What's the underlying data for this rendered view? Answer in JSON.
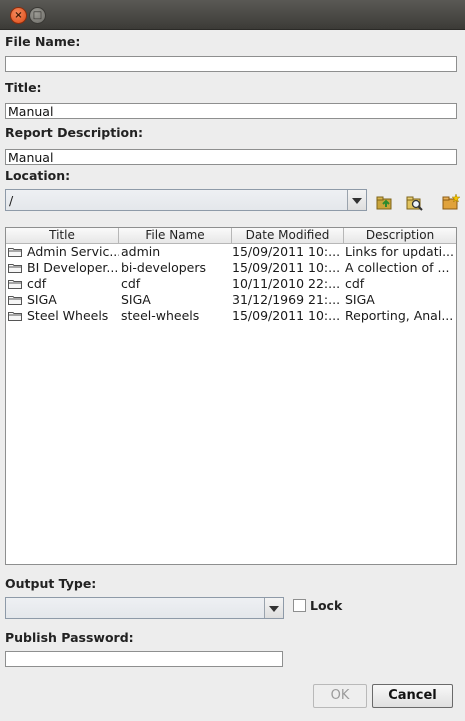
{
  "window": {
    "close_glyph": "×",
    "maximize_glyph": "□"
  },
  "form": {
    "file_name_label": "File Name:",
    "file_name_value": "",
    "title_label": "Title:",
    "title_value": "Manual",
    "description_label": "Report Description:",
    "description_value": "Manual",
    "location_label": "Location:",
    "location_value": "/"
  },
  "toolbar_icons": [
    "folder-up-icon",
    "folder-search-icon",
    "new-folder-icon"
  ],
  "table": {
    "columns": [
      "Title",
      "File Name",
      "Date Modified",
      "Description"
    ],
    "rows": [
      {
        "title": "Admin Servic...",
        "file": "admin",
        "date": "15/09/2011 10:...",
        "desc": "Links for updati..."
      },
      {
        "title": "BI Developer...",
        "file": "bi-developers",
        "date": "15/09/2011 10:...",
        "desc": "A collection of ..."
      },
      {
        "title": "cdf",
        "file": "cdf",
        "date": "10/11/2010 22:...",
        "desc": "cdf"
      },
      {
        "title": "SIGA",
        "file": "SIGA",
        "date": "31/12/1969 21:...",
        "desc": "SIGA"
      },
      {
        "title": "Steel Wheels",
        "file": "steel-wheels",
        "date": "15/09/2011 10:...",
        "desc": "Reporting, Anal..."
      }
    ]
  },
  "output": {
    "label": "Output Type:",
    "value": "",
    "lock_label": "Lock",
    "lock_checked": false
  },
  "publish": {
    "label": "Publish Password:",
    "value": ""
  },
  "buttons": {
    "ok": "OK",
    "cancel": "Cancel"
  }
}
